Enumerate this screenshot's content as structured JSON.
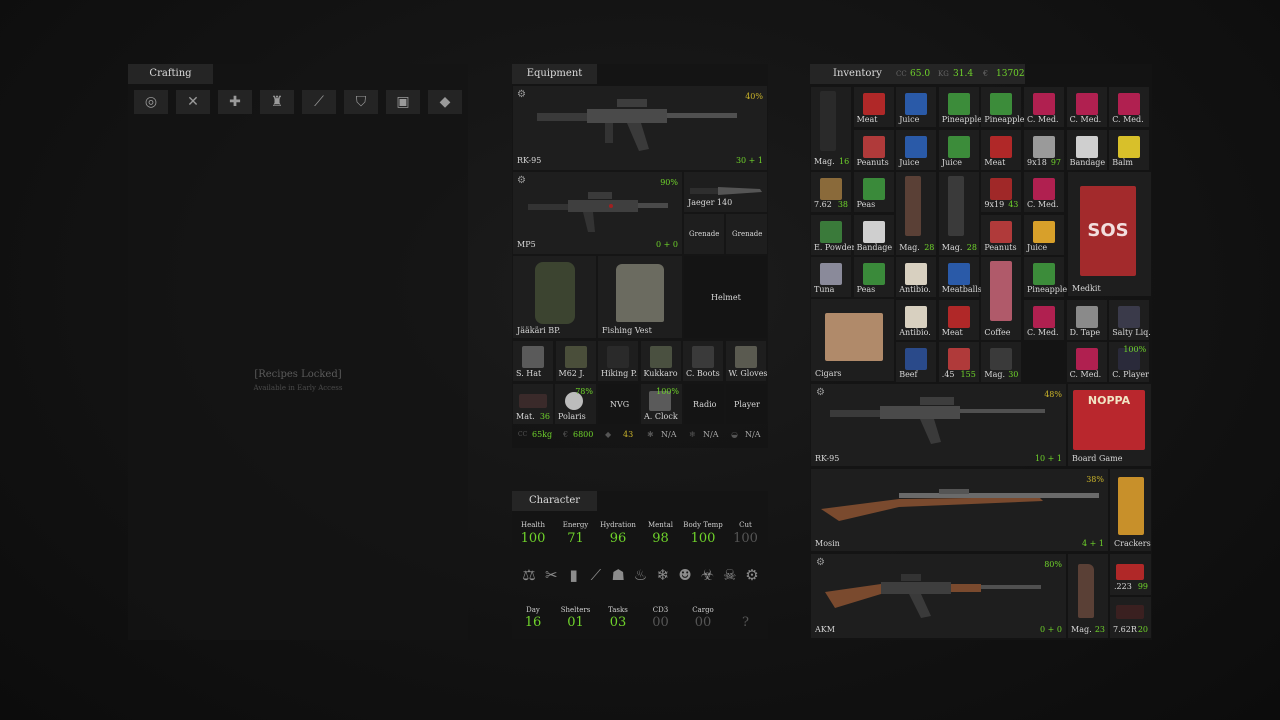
{
  "crafting": {
    "title": "Crafting",
    "tools": [
      {
        "icon": "eye-slash-icon",
        "glyph": "◎"
      },
      {
        "icon": "crossed-tools-icon",
        "glyph": "✕"
      },
      {
        "icon": "medical-cross-icon",
        "glyph": "✚"
      },
      {
        "icon": "jacket-icon",
        "glyph": "♜"
      },
      {
        "icon": "rifle-icon",
        "glyph": "⟋"
      },
      {
        "icon": "shield-icon",
        "glyph": "⛉"
      },
      {
        "icon": "chip-icon",
        "glyph": "▣"
      },
      {
        "icon": "box-icon",
        "glyph": "◆"
      }
    ],
    "locked_title": "[Recipes Locked]",
    "locked_sub": "Available in Early Access"
  },
  "equipment": {
    "title": "Equipment",
    "primary": {
      "name": "RK-95",
      "condition": "40%",
      "ammo": "30 + 1"
    },
    "secondary": {
      "name": "MP5",
      "condition": "90%",
      "ammo": "0 + 0"
    },
    "knife": "Jaeger 140",
    "grenade1": "Grenade",
    "grenade2": "Grenade",
    "backpack": "Jääkäri BP.",
    "vest": "Fishing Vest",
    "helmet": "Helmet",
    "row1": [
      "S. Hat",
      "M62 J.",
      "Hiking P.",
      "Kukkaro",
      "C. Boots",
      "W. Gloves"
    ],
    "row2": {
      "mat": "Mat.",
      "mat_count": "36",
      "polaris": "Polaris",
      "polaris_pct": "78%",
      "nvg": "NVG",
      "aclock": "A. Clock",
      "aclock_pct": "100%",
      "radio": "Radio",
      "player": "Player"
    },
    "footer": {
      "weight": "65kg",
      "money": "6800",
      "armor": "43",
      "na1": "N/A",
      "na2": "N/A",
      "na3": "N/A",
      "cc": "CC"
    }
  },
  "character": {
    "title": "Character",
    "stats": [
      {
        "label": "Health",
        "value": "100"
      },
      {
        "label": "Energy",
        "value": "71"
      },
      {
        "label": "Hydration",
        "value": "96"
      },
      {
        "label": "Mental",
        "value": "98"
      },
      {
        "label": "Body Temp",
        "value": "100"
      },
      {
        "label": "Cut",
        "value": "100"
      }
    ],
    "status_icons": [
      "weight-icon",
      "tools-icon",
      "bottle-icon",
      "skis-icon",
      "person-icon",
      "fire-icon",
      "snowflake-icon",
      "devil-icon",
      "biohazard-icon",
      "skull-icon",
      "gear-icon"
    ],
    "counters": [
      {
        "label": "Day",
        "value": "16"
      },
      {
        "label": "Shelters",
        "value": "01"
      },
      {
        "label": "Tasks",
        "value": "03"
      },
      {
        "label": "CD3",
        "value": "00"
      },
      {
        "label": "Cargo",
        "value": "00"
      },
      {
        "label": "",
        "value": "?"
      }
    ]
  },
  "inventory": {
    "title": "Inventory",
    "cc_label": "CC",
    "cc": "65.0",
    "kg_label": "KG",
    "kg": "31.4",
    "money_label": "€",
    "money": "13702",
    "row1": [
      "Mag.",
      "Meat",
      "Juice",
      "Pineapple",
      "Pineapple",
      "C. Med.",
      "C. Med.",
      "C. Med."
    ],
    "mag1_count": "16",
    "row2": [
      "Peanuts",
      "Juice",
      "Juice",
      "Meat",
      "9x18",
      "Bandage",
      "Balm"
    ],
    "r2_9x18_count": "97",
    "row3": [
      "7.62",
      "Peas",
      "Mag.",
      "Mag.",
      "9x19",
      "C. Med."
    ],
    "r3_762_count": "38",
    "r3_9x19_count": "43",
    "row4": [
      "E. Powder",
      "Bandage",
      "Mag.",
      "Mag.",
      "Peanuts",
      "Juice",
      "Medkit"
    ],
    "r4_mag1": "28",
    "r4_mag2": "28",
    "row5": [
      "Tuna",
      "Peas",
      "Antibio.",
      "Meatballs",
      "Pineapple"
    ],
    "row6": [
      "Antibio.",
      "Meat",
      "Coffee",
      "C. Med.",
      "D. Tape",
      "Salty Liq."
    ],
    "row7": [
      "Cigars",
      "Beef",
      ".45",
      "Mag.",
      "C. Med.",
      "C. Player"
    ],
    "r7_45_count": "155",
    "r7_mag_count": "30",
    "r7_player_pct": "100%",
    "medkit_label": "SOS",
    "board_game_label": "NOPPA",
    "rk95": {
      "name": "RK-95",
      "condition": "48%",
      "ammo": "10 + 1"
    },
    "board_game": "Board Game",
    "mosin": {
      "name": "Mosin",
      "condition": "38%",
      "ammo": "4 + 1"
    },
    "crackers": "Crackers",
    "akm": {
      "name": "AKM",
      "condition": "80%",
      "ammo": "0 + 0"
    },
    "akm_mag": "Mag.",
    "akm_mag_count": "23",
    "ammo223": ".223",
    "ammo223_count": "99",
    "ammo762r": "7.62R",
    "ammo762r_count": "20"
  },
  "colors": {
    "accent_green": "#6fd32b",
    "accent_yellow": "#c9b32a",
    "panel": "#1e1e1e"
  }
}
